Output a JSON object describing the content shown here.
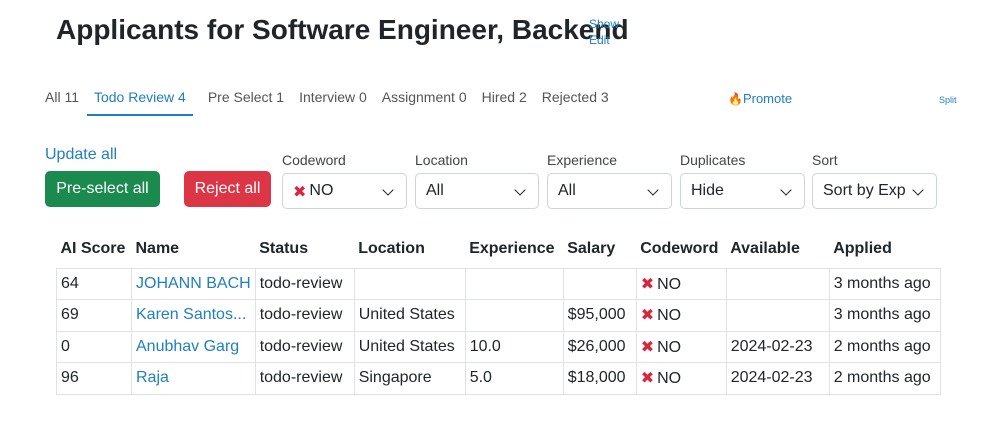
{
  "header": {
    "title": "Applicants for Software Engineer, Backend",
    "show_link": "Show",
    "edit_link": "Edit"
  },
  "tabs": [
    {
      "label": "All 11",
      "active": false
    },
    {
      "label": "Todo Review 4",
      "active": true
    },
    {
      "label": "Pre Select 1",
      "active": false
    },
    {
      "label": "Interview 0",
      "active": false
    },
    {
      "label": "Assignment 0",
      "active": false
    },
    {
      "label": "Hired 2",
      "active": false
    },
    {
      "label": "Rejected 3",
      "active": false
    }
  ],
  "promote": {
    "icon": "fire-icon",
    "label": "Promote"
  },
  "split_link": "Split",
  "actions": {
    "update_all": "Update all",
    "preselect_all": "Pre-select all",
    "reject_all": "Reject all"
  },
  "filters": {
    "codeword": {
      "label": "Codeword",
      "value": "NO"
    },
    "location": {
      "label": "Location",
      "value": "All"
    },
    "experience": {
      "label": "Experience",
      "value": "All"
    },
    "duplicates": {
      "label": "Duplicates",
      "value": "Hide"
    },
    "sort": {
      "label": "Sort",
      "value": "Sort by Exp"
    }
  },
  "table": {
    "headers": {
      "ai_score": "AI Score",
      "name": "Name",
      "status": "Status",
      "location": "Location",
      "experience": "Experience",
      "salary": "Salary",
      "codeword": "Codeword",
      "available": "Available",
      "applied": "Applied"
    },
    "rows": [
      {
        "ai_score": "64",
        "name": "JOHANN BACH",
        "status": "todo-review",
        "location": "",
        "experience": "",
        "salary": "",
        "codeword": "NO",
        "available": "",
        "applied": "3 months ago"
      },
      {
        "ai_score": "69",
        "name": "Karen Santos...",
        "status": "todo-review",
        "location": "United States",
        "experience": "",
        "salary": "$95,000",
        "codeword": "NO",
        "available": "",
        "applied": "3 months ago"
      },
      {
        "ai_score": "0",
        "name": "Anubhav Garg",
        "status": "todo-review",
        "location": "United States",
        "experience": "10.0",
        "salary": "$26,000",
        "codeword": "NO",
        "available": "2024-02-23",
        "applied": "2 months ago"
      },
      {
        "ai_score": "96",
        "name": "Raja",
        "status": "todo-review",
        "location": "Singapore",
        "experience": "5.0",
        "salary": "$18,000",
        "codeword": "NO",
        "available": "2024-02-23",
        "applied": "2 months ago"
      }
    ]
  },
  "colors": {
    "accent": "#1f7fc1",
    "success": "#1a8a4e",
    "danger": "#dc3545",
    "x_mark": "#d7263d"
  }
}
